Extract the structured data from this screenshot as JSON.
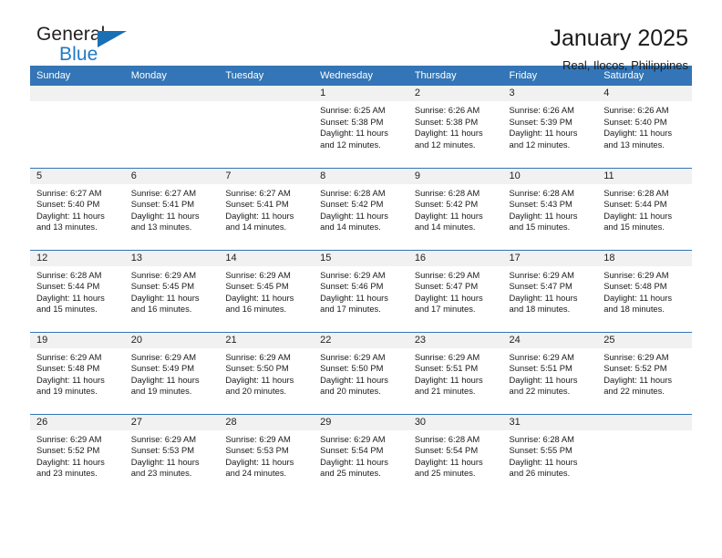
{
  "brand": {
    "name_top": "General",
    "name_bottom": "Blue",
    "triangle_color": "#1a6fb5",
    "blue_color": "#1f7ac4"
  },
  "header": {
    "title": "January 2025",
    "subtitle": "Real, Ilocos, Philippines",
    "accent_color": "#3375b6",
    "daynum_band_color": "#f1f1f1"
  },
  "calendar": {
    "weekday_headers": [
      "Sunday",
      "Monday",
      "Tuesday",
      "Wednesday",
      "Thursday",
      "Friday",
      "Saturday"
    ],
    "labels": {
      "sunrise": "Sunrise:",
      "sunset": "Sunset:",
      "daylight": "Daylight:"
    },
    "weeks": [
      [
        {
          "day": "",
          "empty": true
        },
        {
          "day": "",
          "empty": true
        },
        {
          "day": "",
          "empty": true
        },
        {
          "day": "1",
          "sunrise": "Sunrise: 6:25 AM",
          "sunset": "Sunset: 5:38 PM",
          "daylight": "Daylight: 11 hours and 12 minutes."
        },
        {
          "day": "2",
          "sunrise": "Sunrise: 6:26 AM",
          "sunset": "Sunset: 5:38 PM",
          "daylight": "Daylight: 11 hours and 12 minutes."
        },
        {
          "day": "3",
          "sunrise": "Sunrise: 6:26 AM",
          "sunset": "Sunset: 5:39 PM",
          "daylight": "Daylight: 11 hours and 12 minutes."
        },
        {
          "day": "4",
          "sunrise": "Sunrise: 6:26 AM",
          "sunset": "Sunset: 5:40 PM",
          "daylight": "Daylight: 11 hours and 13 minutes."
        }
      ],
      [
        {
          "day": "5",
          "sunrise": "Sunrise: 6:27 AM",
          "sunset": "Sunset: 5:40 PM",
          "daylight": "Daylight: 11 hours and 13 minutes."
        },
        {
          "day": "6",
          "sunrise": "Sunrise: 6:27 AM",
          "sunset": "Sunset: 5:41 PM",
          "daylight": "Daylight: 11 hours and 13 minutes."
        },
        {
          "day": "7",
          "sunrise": "Sunrise: 6:27 AM",
          "sunset": "Sunset: 5:41 PM",
          "daylight": "Daylight: 11 hours and 14 minutes."
        },
        {
          "day": "8",
          "sunrise": "Sunrise: 6:28 AM",
          "sunset": "Sunset: 5:42 PM",
          "daylight": "Daylight: 11 hours and 14 minutes."
        },
        {
          "day": "9",
          "sunrise": "Sunrise: 6:28 AM",
          "sunset": "Sunset: 5:42 PM",
          "daylight": "Daylight: 11 hours and 14 minutes."
        },
        {
          "day": "10",
          "sunrise": "Sunrise: 6:28 AM",
          "sunset": "Sunset: 5:43 PM",
          "daylight": "Daylight: 11 hours and 15 minutes."
        },
        {
          "day": "11",
          "sunrise": "Sunrise: 6:28 AM",
          "sunset": "Sunset: 5:44 PM",
          "daylight": "Daylight: 11 hours and 15 minutes."
        }
      ],
      [
        {
          "day": "12",
          "sunrise": "Sunrise: 6:28 AM",
          "sunset": "Sunset: 5:44 PM",
          "daylight": "Daylight: 11 hours and 15 minutes."
        },
        {
          "day": "13",
          "sunrise": "Sunrise: 6:29 AM",
          "sunset": "Sunset: 5:45 PM",
          "daylight": "Daylight: 11 hours and 16 minutes."
        },
        {
          "day": "14",
          "sunrise": "Sunrise: 6:29 AM",
          "sunset": "Sunset: 5:45 PM",
          "daylight": "Daylight: 11 hours and 16 minutes."
        },
        {
          "day": "15",
          "sunrise": "Sunrise: 6:29 AM",
          "sunset": "Sunset: 5:46 PM",
          "daylight": "Daylight: 11 hours and 17 minutes."
        },
        {
          "day": "16",
          "sunrise": "Sunrise: 6:29 AM",
          "sunset": "Sunset: 5:47 PM",
          "daylight": "Daylight: 11 hours and 17 minutes."
        },
        {
          "day": "17",
          "sunrise": "Sunrise: 6:29 AM",
          "sunset": "Sunset: 5:47 PM",
          "daylight": "Daylight: 11 hours and 18 minutes."
        },
        {
          "day": "18",
          "sunrise": "Sunrise: 6:29 AM",
          "sunset": "Sunset: 5:48 PM",
          "daylight": "Daylight: 11 hours and 18 minutes."
        }
      ],
      [
        {
          "day": "19",
          "sunrise": "Sunrise: 6:29 AM",
          "sunset": "Sunset: 5:48 PM",
          "daylight": "Daylight: 11 hours and 19 minutes."
        },
        {
          "day": "20",
          "sunrise": "Sunrise: 6:29 AM",
          "sunset": "Sunset: 5:49 PM",
          "daylight": "Daylight: 11 hours and 19 minutes."
        },
        {
          "day": "21",
          "sunrise": "Sunrise: 6:29 AM",
          "sunset": "Sunset: 5:50 PM",
          "daylight": "Daylight: 11 hours and 20 minutes."
        },
        {
          "day": "22",
          "sunrise": "Sunrise: 6:29 AM",
          "sunset": "Sunset: 5:50 PM",
          "daylight": "Daylight: 11 hours and 20 minutes."
        },
        {
          "day": "23",
          "sunrise": "Sunrise: 6:29 AM",
          "sunset": "Sunset: 5:51 PM",
          "daylight": "Daylight: 11 hours and 21 minutes."
        },
        {
          "day": "24",
          "sunrise": "Sunrise: 6:29 AM",
          "sunset": "Sunset: 5:51 PM",
          "daylight": "Daylight: 11 hours and 22 minutes."
        },
        {
          "day": "25",
          "sunrise": "Sunrise: 6:29 AM",
          "sunset": "Sunset: 5:52 PM",
          "daylight": "Daylight: 11 hours and 22 minutes."
        }
      ],
      [
        {
          "day": "26",
          "sunrise": "Sunrise: 6:29 AM",
          "sunset": "Sunset: 5:52 PM",
          "daylight": "Daylight: 11 hours and 23 minutes."
        },
        {
          "day": "27",
          "sunrise": "Sunrise: 6:29 AM",
          "sunset": "Sunset: 5:53 PM",
          "daylight": "Daylight: 11 hours and 23 minutes."
        },
        {
          "day": "28",
          "sunrise": "Sunrise: 6:29 AM",
          "sunset": "Sunset: 5:53 PM",
          "daylight": "Daylight: 11 hours and 24 minutes."
        },
        {
          "day": "29",
          "sunrise": "Sunrise: 6:29 AM",
          "sunset": "Sunset: 5:54 PM",
          "daylight": "Daylight: 11 hours and 25 minutes."
        },
        {
          "day": "30",
          "sunrise": "Sunrise: 6:28 AM",
          "sunset": "Sunset: 5:54 PM",
          "daylight": "Daylight: 11 hours and 25 minutes."
        },
        {
          "day": "31",
          "sunrise": "Sunrise: 6:28 AM",
          "sunset": "Sunset: 5:55 PM",
          "daylight": "Daylight: 11 hours and 26 minutes."
        },
        {
          "day": "",
          "empty": true
        }
      ]
    ]
  }
}
